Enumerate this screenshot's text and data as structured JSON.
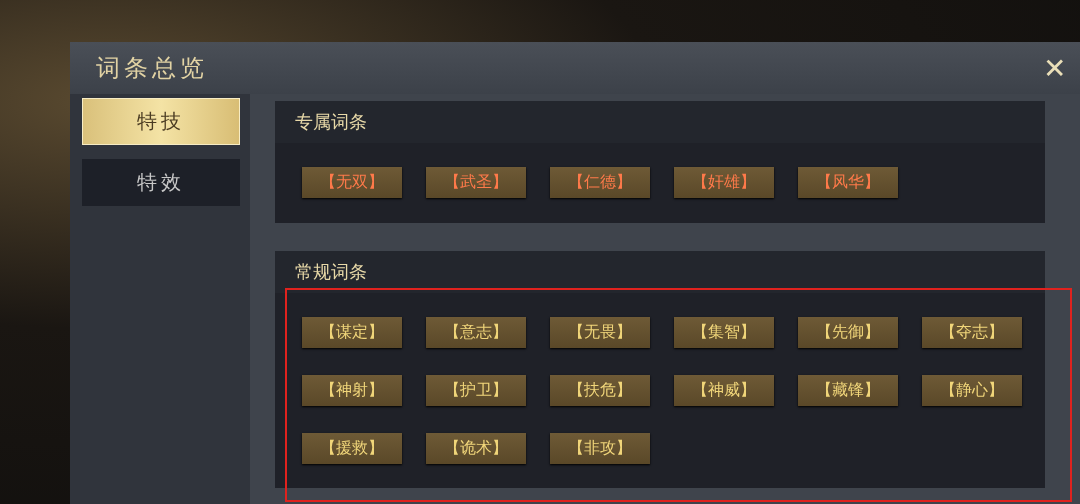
{
  "window": {
    "title": "词条总览",
    "close": "✕"
  },
  "tabs": [
    {
      "label": "特技",
      "selected": true
    },
    {
      "label": "特效",
      "selected": false
    }
  ],
  "sections": [
    {
      "title": "专属词条",
      "kind": "exclusive",
      "terms": [
        "【无双】",
        "【武圣】",
        "【仁德】",
        "【奸雄】",
        "【风华】"
      ]
    },
    {
      "title": "常规词条",
      "kind": "regular",
      "terms": [
        "【谋定】",
        "【意志】",
        "【无畏】",
        "【集智】",
        "【先御】",
        "【夺志】",
        "【神射】",
        "【护卫】",
        "【扶危】",
        "【神威】",
        "【藏锋】",
        "【静心】",
        "【援救】",
        "【诡术】",
        "【非攻】"
      ]
    }
  ]
}
